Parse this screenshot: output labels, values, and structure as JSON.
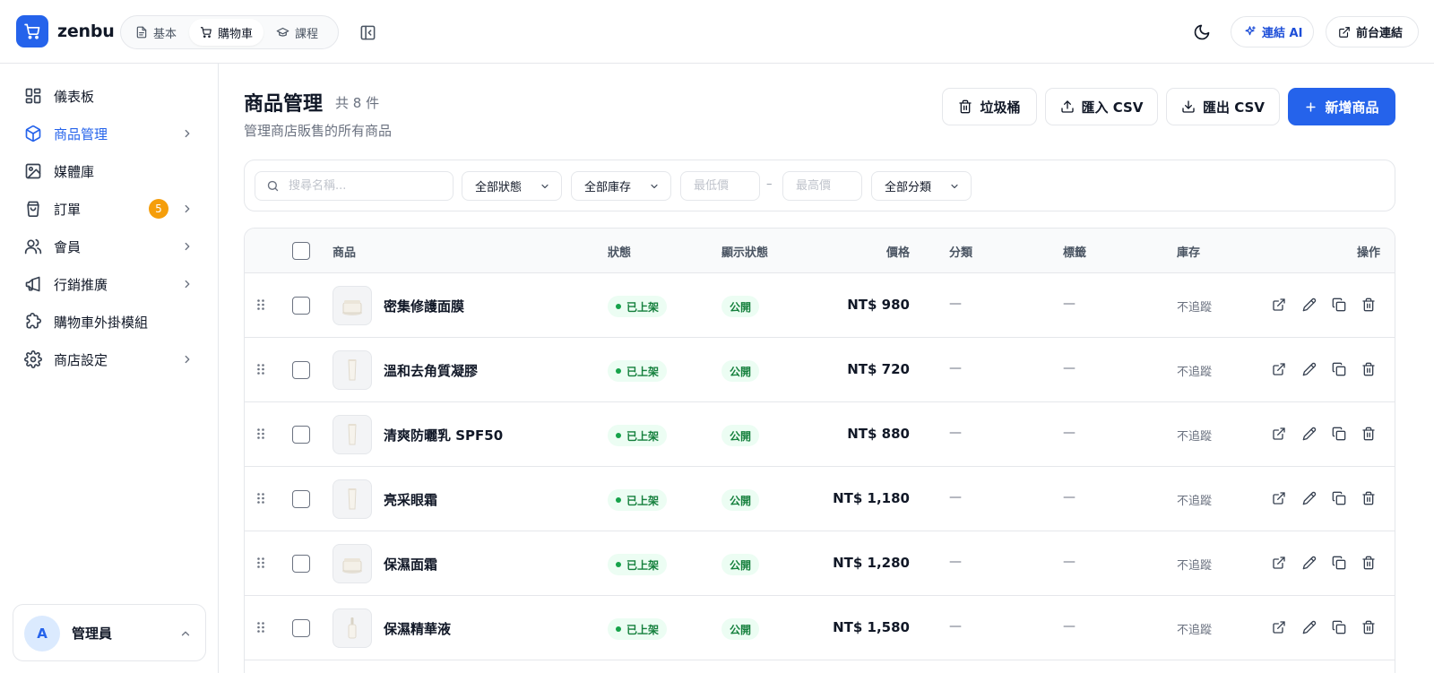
{
  "app": {
    "brand": "zenbu",
    "accent": "#2563eb"
  },
  "topbar": {
    "modes": [
      {
        "label": "基本",
        "icon": "document-icon",
        "active": false
      },
      {
        "label": "購物車",
        "icon": "cart-icon",
        "active": true
      },
      {
        "label": "課程",
        "icon": "graduation-cap-icon",
        "active": false
      }
    ],
    "ai_label": "連結 AI",
    "frontend_label": "前台連結"
  },
  "sidebar": {
    "items": [
      {
        "label": "儀表板",
        "icon": "dashboard-icon",
        "active": false,
        "has_chevron": false
      },
      {
        "label": "商品管理",
        "icon": "package-icon",
        "active": true,
        "has_chevron": true
      },
      {
        "label": "媒體庫",
        "icon": "image-icon",
        "active": false,
        "has_chevron": false
      },
      {
        "label": "訂單",
        "icon": "shopping-bag-icon",
        "active": false,
        "has_chevron": true,
        "badge": "5"
      },
      {
        "label": "會員",
        "icon": "users-icon",
        "active": false,
        "has_chevron": true
      },
      {
        "label": "行銷推廣",
        "icon": "megaphone-icon",
        "active": false,
        "has_chevron": true
      },
      {
        "label": "購物車外掛模組",
        "icon": "puzzle-icon",
        "active": false,
        "has_chevron": false
      },
      {
        "label": "商店設定",
        "icon": "gear-icon",
        "active": false,
        "has_chevron": true
      }
    ],
    "user": {
      "initial": "A",
      "name": "管理員"
    }
  },
  "main": {
    "title": "商品管理",
    "count": "共 8 件",
    "subtitle": "管理商店販售的所有商品",
    "actions": {
      "trash": "垃圾桶",
      "import": "匯入 CSV",
      "export": "匯出 CSV",
      "add": "新增商品"
    },
    "filters": {
      "search_placeholder": "搜尋名稱...",
      "status": "全部狀態",
      "stock": "全部庫存",
      "min_price_placeholder": "最低價",
      "max_price_placeholder": "最高價",
      "category": "全部分類",
      "range_sep": "–"
    },
    "table": {
      "columns": {
        "product": "商品",
        "status": "狀態",
        "visibility": "顯示狀態",
        "price": "價格",
        "category": "分類",
        "tags": "標籤",
        "stock": "庫存",
        "actions": "操作"
      },
      "rows": [
        {
          "name": "密集修護面膜",
          "status": "已上架",
          "visibility": "公開",
          "price": "NT$ 980",
          "category": "—",
          "tags": "—",
          "stock": "不追蹤",
          "thumb": "jar"
        },
        {
          "name": "溫和去角質凝膠",
          "status": "已上架",
          "visibility": "公開",
          "price": "NT$ 720",
          "category": "—",
          "tags": "—",
          "stock": "不追蹤",
          "thumb": "tube"
        },
        {
          "name": "清爽防曬乳 SPF50",
          "status": "已上架",
          "visibility": "公開",
          "price": "NT$ 880",
          "category": "—",
          "tags": "—",
          "stock": "不追蹤",
          "thumb": "tube"
        },
        {
          "name": "亮采眼霜",
          "status": "已上架",
          "visibility": "公開",
          "price": "NT$ 1,180",
          "category": "—",
          "tags": "—",
          "stock": "不追蹤",
          "thumb": "tube"
        },
        {
          "name": "保濕面霜",
          "status": "已上架",
          "visibility": "公開",
          "price": "NT$ 1,280",
          "category": "—",
          "tags": "—",
          "stock": "不追蹤",
          "thumb": "jar"
        },
        {
          "name": "保濕精華液",
          "status": "已上架",
          "visibility": "公開",
          "price": "NT$ 1,580",
          "category": "—",
          "tags": "—",
          "stock": "不追蹤",
          "thumb": "dropper"
        }
      ]
    }
  }
}
